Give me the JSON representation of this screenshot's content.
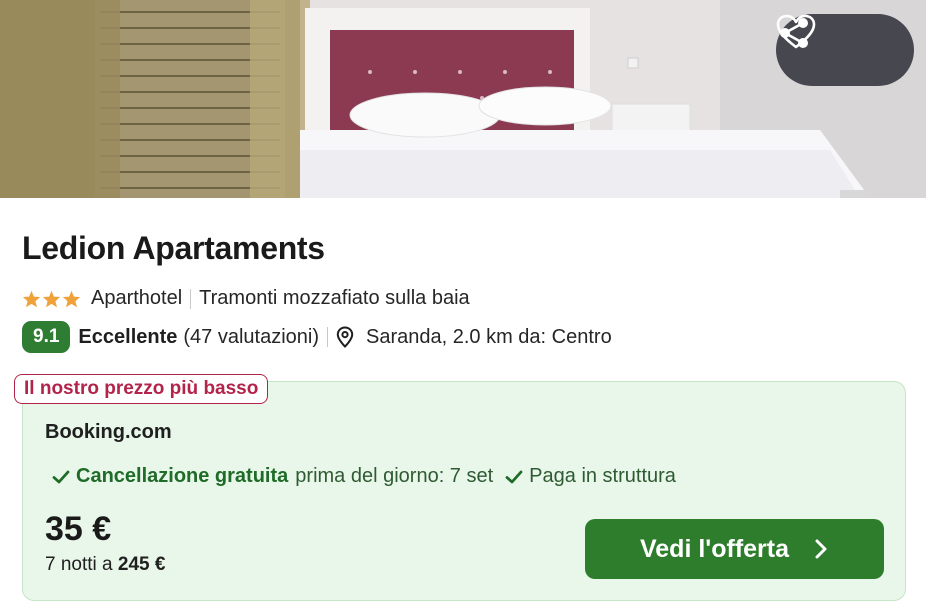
{
  "hotel": {
    "name": "Ledion Apartaments",
    "star_count": 3,
    "type": "Aparthotel",
    "tagline": "Tramonti mozzafiato sulla baia"
  },
  "rating": {
    "score": "9.1",
    "label": "Eccellente",
    "reviews": "(47 valutazioni)",
    "location": "Saranda, 2.0 km da: Centro"
  },
  "offer": {
    "badge": "Il nostro prezzo più basso",
    "provider": "Booking.com",
    "perk1_strong": "Cancellazione gratuita",
    "perk1_text": "prima del giorno: 7 set",
    "perk2": "Paga in struttura",
    "price": "35 €",
    "total_prefix": "7 notti a",
    "total_value": "245 €",
    "cta_label": "Vedi l'offerta"
  },
  "colors": {
    "rating_badge": "#2e7d32",
    "cta": "#2e7d2c",
    "best_price_tag": "#b3244a",
    "offer_background": "#e8f7e9",
    "star": "#f0a23a"
  },
  "icons": {
    "share": "share-icon",
    "favorite": "heart-icon",
    "star": "star-icon",
    "location": "map-pin-icon",
    "check": "check-icon",
    "chevron": "chevron-right-icon"
  }
}
